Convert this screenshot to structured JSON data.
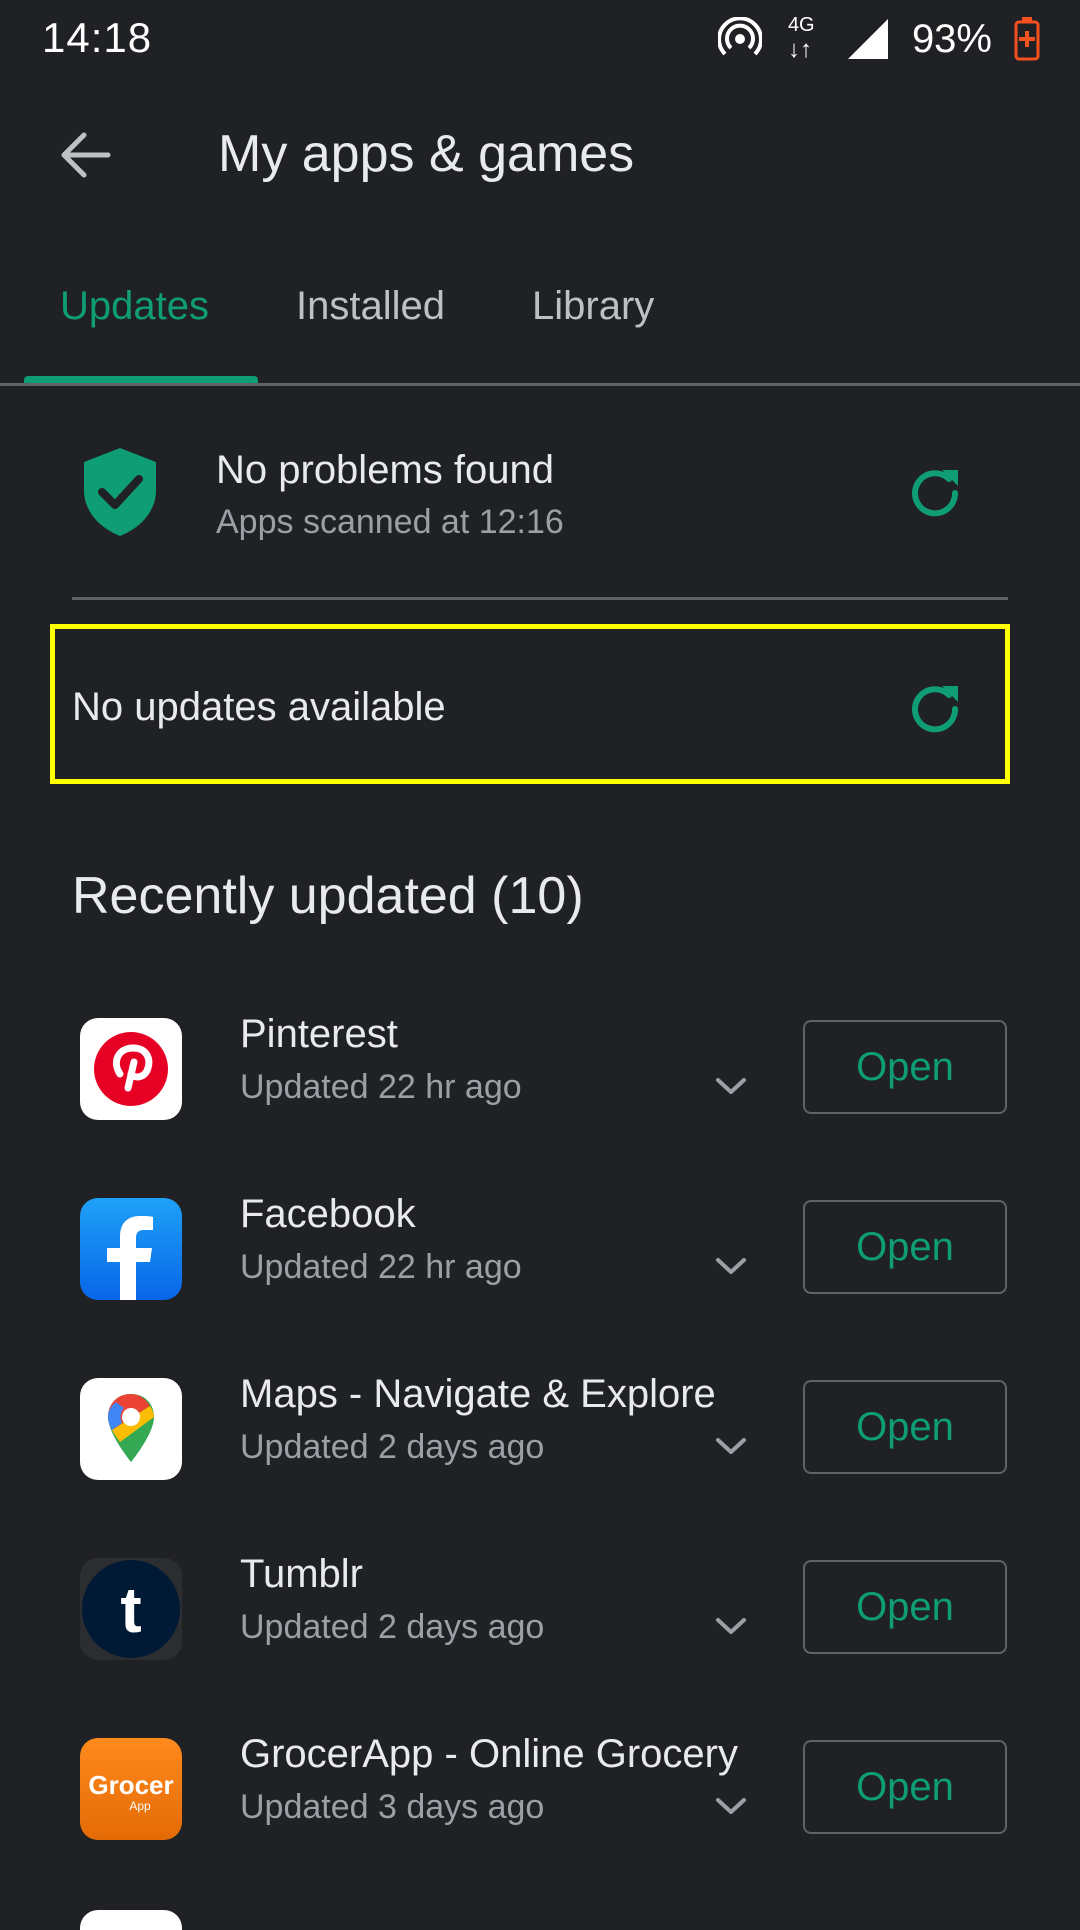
{
  "status_bar": {
    "time": "14:18",
    "network": "4G",
    "battery": "93%"
  },
  "header": {
    "title": "My apps & games"
  },
  "tabs": [
    {
      "label": "Updates",
      "active": true
    },
    {
      "label": "Installed",
      "active": false
    },
    {
      "label": "Library",
      "active": false
    }
  ],
  "security": {
    "title": "No problems found",
    "subtitle": "Apps scanned at 12:16"
  },
  "updates": {
    "status": "No updates available"
  },
  "recent": {
    "title": "Recently updated (10)",
    "open_label": "Open",
    "apps": [
      {
        "name": "Pinterest",
        "updated": "Updated 22 hr ago",
        "icon": "pinterest-icon"
      },
      {
        "name": "Facebook",
        "updated": "Updated 22 hr ago",
        "icon": "facebook-icon"
      },
      {
        "name": "Maps - Navigate & Explore",
        "updated": "Updated 2 days ago",
        "icon": "maps-icon"
      },
      {
        "name": "Tumblr",
        "updated": "Updated 2 days ago",
        "icon": "tumblr-icon"
      },
      {
        "name": "GrocerApp - Online Grocery",
        "updated": "Updated 3 days ago",
        "icon": "grocerapp-icon"
      }
    ]
  },
  "colors": {
    "accent": "#0f9d75",
    "background": "#202124",
    "highlight": "#ffff00"
  }
}
